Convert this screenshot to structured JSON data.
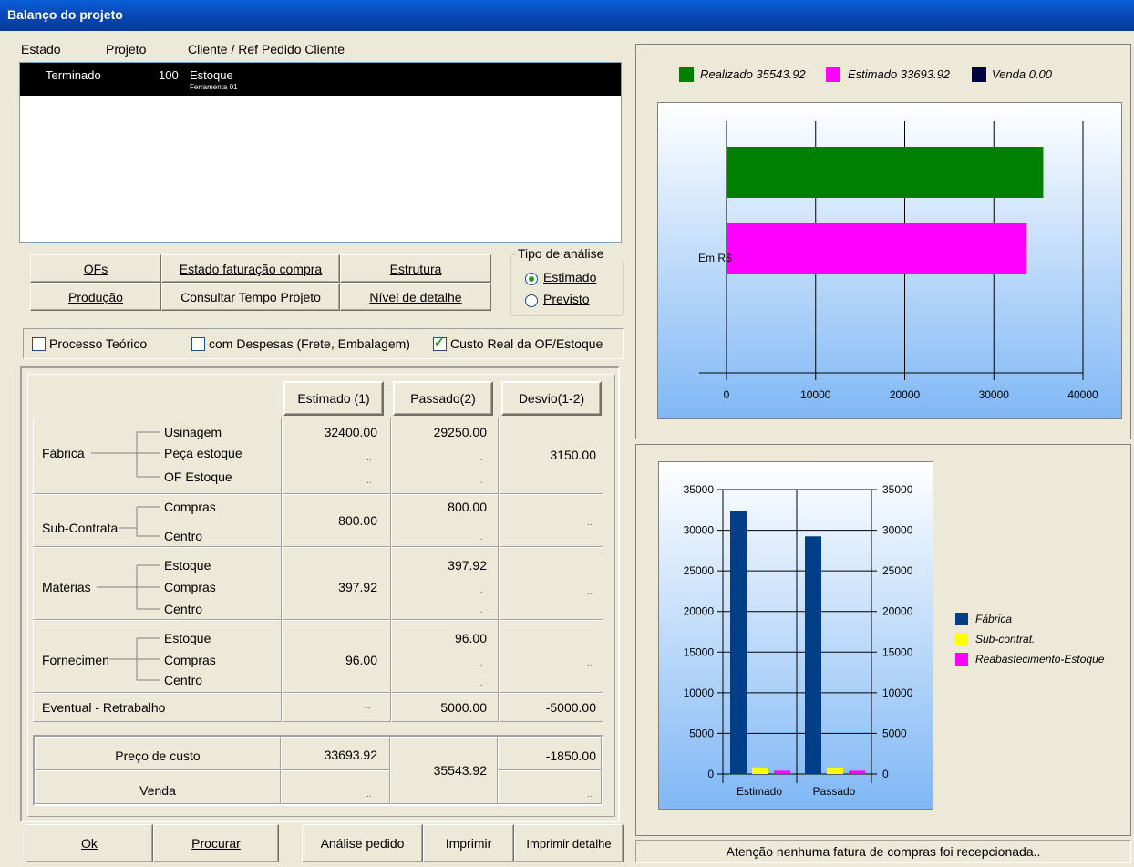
{
  "window": {
    "title": "Balanço do projeto"
  },
  "list": {
    "headers": [
      "Estado",
      "Projeto",
      "Cliente / Ref Pedido Cliente"
    ],
    "rows": [
      {
        "estado": "Terminado",
        "projeto": "100",
        "cliente": "Estoque",
        "ref": "Ferramenta 01"
      }
    ]
  },
  "buttons": {
    "ofs": "OFs",
    "estado_faturacao": "Estado faturação compra",
    "estrutura": "Estrutura",
    "producao": "Produção",
    "consultar_tempo": "Consultar Tempo Projeto",
    "nivel_detalhe": "Nível de detalhe",
    "ok": "Ok",
    "procurar": "Procurar",
    "analise_pedido": "Análise pedido",
    "imprimir": "Imprimir",
    "imprimir_detalhe": "Imprimir detalhe"
  },
  "analysis_type": {
    "label": "Tipo de análise",
    "options": [
      {
        "label": "Estimado",
        "selected": true
      },
      {
        "label": "Previsto",
        "selected": false
      }
    ]
  },
  "options": [
    {
      "label": "Processo Teórico",
      "checked": false
    },
    {
      "label": "com Despesas (Frete, Embalagem)",
      "checked": false
    },
    {
      "label": "Custo Real da OF/Estoque",
      "checked": true
    }
  ],
  "table": {
    "col_headers": [
      "Estimado (1)",
      "Passado(2)",
      "Desvio(1-2)"
    ],
    "fabrica": {
      "label": "Fábrica",
      "items": [
        "Usinagem",
        "Peça estoque",
        "OF Estoque"
      ],
      "estimado": "32400.00",
      "passado": "29250.00",
      "desvio": "3150.00"
    },
    "subcontrata": {
      "label": "Sub-Contrata",
      "items": [
        "Compras",
        "Centro"
      ],
      "estimado": "800.00",
      "passado": "800.00",
      "desvio": ".."
    },
    "materias": {
      "label": "Matérias",
      "items": [
        "Estoque",
        "Compras",
        "Centro"
      ],
      "estimado": "397.92",
      "passado": "397.92",
      "desvio": ".."
    },
    "fornecimento": {
      "label": "Fornecimen",
      "items": [
        "Estoque",
        "Compras",
        "Centro"
      ],
      "estimado": "96.00",
      "passado": "96.00",
      "desvio": ".."
    },
    "eventual": {
      "label": "Eventual - Retrabalho",
      "estimado": "--",
      "passado": "5000.00",
      "desvio": "-5000.00"
    },
    "dots": "..",
    "totals": {
      "preco_custo": {
        "label": "Preço de custo",
        "estimado": "33693.92",
        "desvio": "-1850.00"
      },
      "passado_total": "35543.92",
      "venda": {
        "label": "Venda",
        "estimado": "..",
        "desvio": ".."
      }
    }
  },
  "status": "Atenção nenhuma fatura de compras foi recepcionada..",
  "chart_data": [
    {
      "type": "bar",
      "orientation": "horizontal",
      "categories": [
        "Em R$"
      ],
      "series": [
        {
          "name": "Realizado 35543.92",
          "values": [
            35543.92
          ],
          "color": "#008000"
        },
        {
          "name": "Estimado 33693.92",
          "values": [
            33693.92
          ],
          "color": "#ff00ff"
        },
        {
          "name": "Venda 0.00",
          "values": [
            0
          ],
          "color": "#000040"
        }
      ],
      "xlim": [
        0,
        40000
      ],
      "xticks": [
        "0",
        "10000",
        "20000",
        "30000",
        "40000"
      ],
      "legend": "top"
    },
    {
      "type": "bar",
      "categories": [
        "Estimado",
        "Passado"
      ],
      "series": [
        {
          "name": "Fábrica",
          "values": [
            32400,
            29250
          ],
          "color": "#003f87"
        },
        {
          "name": "Sub-contrat.",
          "values": [
            800,
            800
          ],
          "color": "#ffff00"
        },
        {
          "name": "Reabastecimento-Estoque",
          "values": [
            397.92,
            397.92
          ],
          "color": "#ff00ff"
        }
      ],
      "ylim": [
        0,
        35000
      ],
      "yticks": [
        "0",
        "5000",
        "10000",
        "15000",
        "20000",
        "25000",
        "30000",
        "35000"
      ],
      "legend": "right"
    }
  ]
}
